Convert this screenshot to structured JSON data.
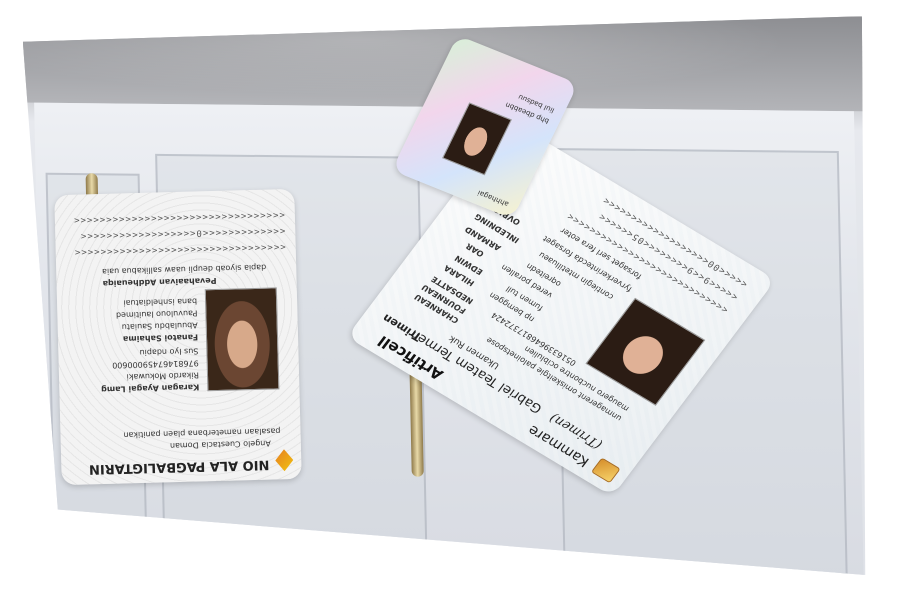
{
  "scene": {
    "type": "photo-with-id-cards",
    "colors": {
      "background": "#ffffff",
      "cabinet": "#e2e5ea",
      "ceiling": "#9fa0a4",
      "handle": "#d8c48f"
    }
  },
  "card_left": {
    "header": "NIO ALA PAGBALIGTARIN",
    "lines": [
      "Angelo Cuestacia Doman",
      "pasalaan nameterbana plaen panitikan",
      "Karagan Ayagai Lamg",
      "Rikardo Mokuwaki",
      "97681467459000600",
      "Sus Iyo ndapiu",
      "Fanatoi Sahaima",
      "Abuulabdu Sauiatu",
      "Pauvulouo lauitimed",
      "bana isnheldiatuai",
      "Pevahaaivan Addheuaiqa",
      "dapia siyoab deupli uaaw sallikabua uaia"
    ],
    "mrz": [
      "<<<<<<<<<<<<<<<<<<<<<<<<<<<<<<<<<",
      "<<<<<<<<<<<<<0<<<<<<<<<<<<<<<<<<",
      "<<<<<<<<<<<<<<<<<<<<<<<<<<<<<<<<<"
    ]
  },
  "card_right": {
    "title": "Artificell",
    "subtitle": "Kammare",
    "name": "Gabriel Teatem Termen",
    "name_note": "(Trimen)",
    "label_trimen": "Trimen",
    "label_trimen_val": "Ukamen Ruk",
    "fields": [
      {
        "label": "CHARNEAU",
        "value": "unmagerent omiskeitgie paloinetspose"
      },
      {
        "label": "FOURNEAU",
        "value": "maugero nucbontre ociblulien"
      },
      {
        "label": "NEDSATTE",
        "value": "0516339646817372424"
      },
      {
        "label": "HILARA",
        "value": "np bemggen"
      },
      {
        "label": "EDWIN",
        "value": "fumen tull"
      },
      {
        "label": "OAR",
        "value": "vered porallen"
      },
      {
        "label": "ARMAND",
        "value": "oqreitedn"
      },
      {
        "label": "INLEDNING",
        "value": "contiegin mtetilluaeu"
      },
      {
        "label": "OVRIG",
        "value": "fyrverkerintecda forsaget"
      }
    ],
    "footer": "forsaget serl fera eoter",
    "mrz": [
      "<<<<<<<<<<<<<<<<<<<<<<<<<<<<<",
      "<<<<<9<<9<<<<<<<<05<<<<<<",
      "<<<<<00<<<<<<<<<<<<<<<<<<<"
    ]
  },
  "card_small": {
    "lines": [
      "ahhhagai",
      "bhp dbeabbn",
      "liul badsuu"
    ]
  }
}
